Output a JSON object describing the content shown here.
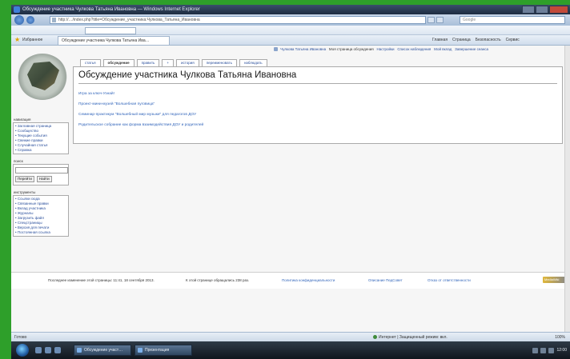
{
  "browser": {
    "title": "Обсуждение участника Чулкова Татьяна Ивановна — Windows Internet Explorer",
    "address": "http://…/index.php?title=Обсуждение_участника:Чулкова_Татьяна_Ивановна",
    "search_placeholder": "Google",
    "tab_label": "Обсуждение участника Чулкова Татьяна Ива…",
    "favorites_label": "Избранное",
    "cmd_items": [
      "Главная",
      "Страница",
      "Безопасность",
      "Сервис"
    ]
  },
  "wiki": {
    "personal_bar": [
      "Чулкова Татьяна Ивановна",
      "Моя страница обсуждения",
      "Настройки",
      "Список наблюдения",
      "Мой вклад",
      "Завершение сеанса"
    ],
    "page_tabs": [
      "статья",
      "обсуждение",
      "править",
      "+",
      "история",
      "переименовать",
      "наблюдать"
    ],
    "heading": "Обсуждение участника Чулкова Татьяна Ивановна",
    "links": [
      "Игра за ключ-Узнай!",
      "Проект-мини-музей \"Волшебная пуговица\"",
      "Семинар-практикум \"Волшебный мир музыки\" для педагогов ДОУ",
      "Родительское собрание как форма взаимодействия ДОУ и родителей"
    ],
    "sidebar": {
      "nav_header": "навигация",
      "nav_items": [
        "Заглавная страница",
        "Сообщество",
        "Текущие события",
        "Свежие правки",
        "Случайная статья",
        "Справка"
      ],
      "search_header": "поиск",
      "search_buttons": [
        "Перейти",
        "Найти"
      ],
      "tools_header": "инструменты",
      "tools_items": [
        "Ссылки сюда",
        "Связанные правки",
        "Вклад участника",
        "Журналы",
        "Загрузить файл",
        "Спецстраницы",
        "Версия для печати",
        "Постоянная ссылка"
      ]
    },
    "footer": {
      "modified": "Последнее изменение этой страницы: 11:41, 18 сентября 2013.",
      "views": "К этой странице обращались 238 раз.",
      "privacy": "Политика конфиденциальности",
      "about": "Описание ПедСовет",
      "disclaimers": "Отказ от ответственности",
      "badge": "MediaWiki"
    }
  },
  "status": {
    "left": "Готово",
    "zone": "Интернет | Защищенный режим: вкл.",
    "zoom": "100%"
  },
  "taskbar": {
    "tasks": [
      "Обсуждение участ…",
      "Презентация"
    ],
    "clock": "12:00"
  }
}
